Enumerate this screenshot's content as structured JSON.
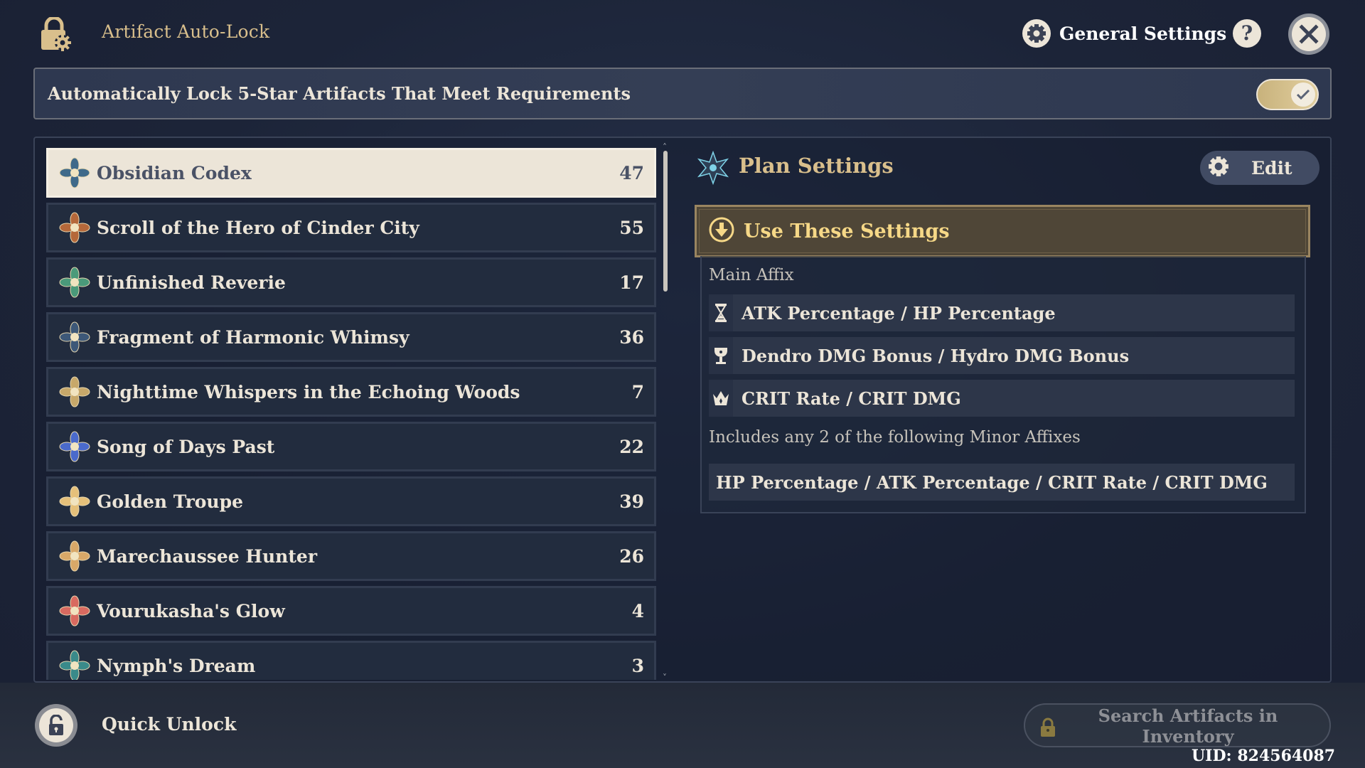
{
  "header": {
    "icon": "lock-gear-icon",
    "title": "Artifact Auto-Lock",
    "general_settings_label": "General Settings",
    "help_icon": "question-icon",
    "close_icon": "close-icon"
  },
  "auto_lock": {
    "label": "Automatically Lock 5-Star Artifacts That Meet Requirements",
    "enabled": true
  },
  "artifact_sets": [
    {
      "name": "Obsidian Codex",
      "count": "47",
      "selected": true,
      "icon_color": "#3f6a8a"
    },
    {
      "name": "Scroll of the Hero of Cinder City",
      "count": "55",
      "selected": false,
      "icon_color": "#b5683a"
    },
    {
      "name": "Unfinished Reverie",
      "count": "17",
      "selected": false,
      "icon_color": "#4a9a7a"
    },
    {
      "name": "Fragment of Harmonic Whimsy",
      "count": "36",
      "selected": false,
      "icon_color": "#3d5878"
    },
    {
      "name": "Nighttime Whispers in the Echoing Woods",
      "count": "7",
      "selected": false,
      "icon_color": "#c7a86a"
    },
    {
      "name": "Song of Days Past",
      "count": "22",
      "selected": false,
      "icon_color": "#4a6acb"
    },
    {
      "name": "Golden Troupe",
      "count": "39",
      "selected": false,
      "icon_color": "#e5c07a"
    },
    {
      "name": "Marechaussee Hunter",
      "count": "26",
      "selected": false,
      "icon_color": "#d8a868"
    },
    {
      "name": "Vourukasha's Glow",
      "count": "4",
      "selected": false,
      "icon_color": "#d86a60"
    },
    {
      "name": "Nymph's Dream",
      "count": "3",
      "selected": false,
      "icon_color": "#3a8a8a"
    }
  ],
  "plan": {
    "title": "Plan Settings",
    "edit_label": "Edit",
    "use_settings_label": "Use These Settings",
    "main_affix_label": "Main Affix",
    "main_affixes": [
      {
        "slot_icon": "hourglass-icon",
        "text": "ATK Percentage / HP Percentage"
      },
      {
        "slot_icon": "goblet-icon",
        "text": "Dendro DMG Bonus / Hydro DMG Bonus"
      },
      {
        "slot_icon": "circlet-icon",
        "text": "CRIT Rate / CRIT DMG"
      }
    ],
    "minor_affix_label": "Includes any 2 of the following Minor Affixes",
    "minor_affixes": "HP Percentage / ATK Percentage / CRIT Rate / CRIT DMG"
  },
  "footer": {
    "quick_unlock_label": "Quick Unlock",
    "search_label": "Search Artifacts in Inventory",
    "uid": "UID: 824564087"
  },
  "colors": {
    "gold_title": "#d9bf8c",
    "cream": "#ece5d8",
    "use_settings_text": "#f6d887"
  }
}
